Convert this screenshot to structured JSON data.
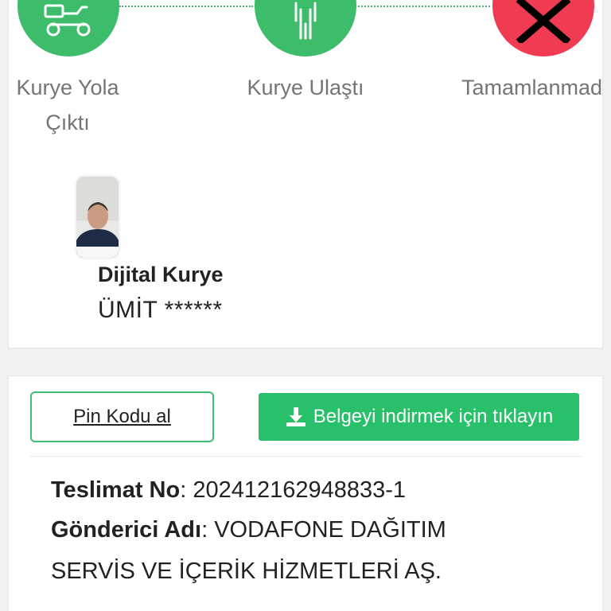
{
  "progress": {
    "steps": [
      {
        "label_line1": "Kurye Yola",
        "label_line2": "Çıktı",
        "icon": "scooter-icon",
        "status": "done"
      },
      {
        "label_line1": "Kurye Ulaştı",
        "icon": "person-icon",
        "status": "done"
      },
      {
        "label_line1": "Tamamlanmad",
        "icon": "close-icon",
        "status": "failed"
      }
    ],
    "colors": {
      "done": "#3dbd6b",
      "failed": "#f03b52",
      "connector": "#46b86f"
    }
  },
  "courier": {
    "title": "Dijital Kurye",
    "name": "ÜMİT ******"
  },
  "actions": {
    "pin_label": "Pin Kodu al",
    "download_label": "Belgeyi indirmek için tıklayın",
    "download_icon": "download-icon",
    "accent": "#28c06a"
  },
  "shipment": {
    "delivery_no_label": "Teslimat No",
    "delivery_no_value": "202412162948833-1",
    "sender_label": "Gönderici Adı",
    "sender_value_line1": "VODAFONE DAĞITIM",
    "sender_value_line2": "SERVİS VE İÇERİK HİZMETLERİ AŞ."
  }
}
